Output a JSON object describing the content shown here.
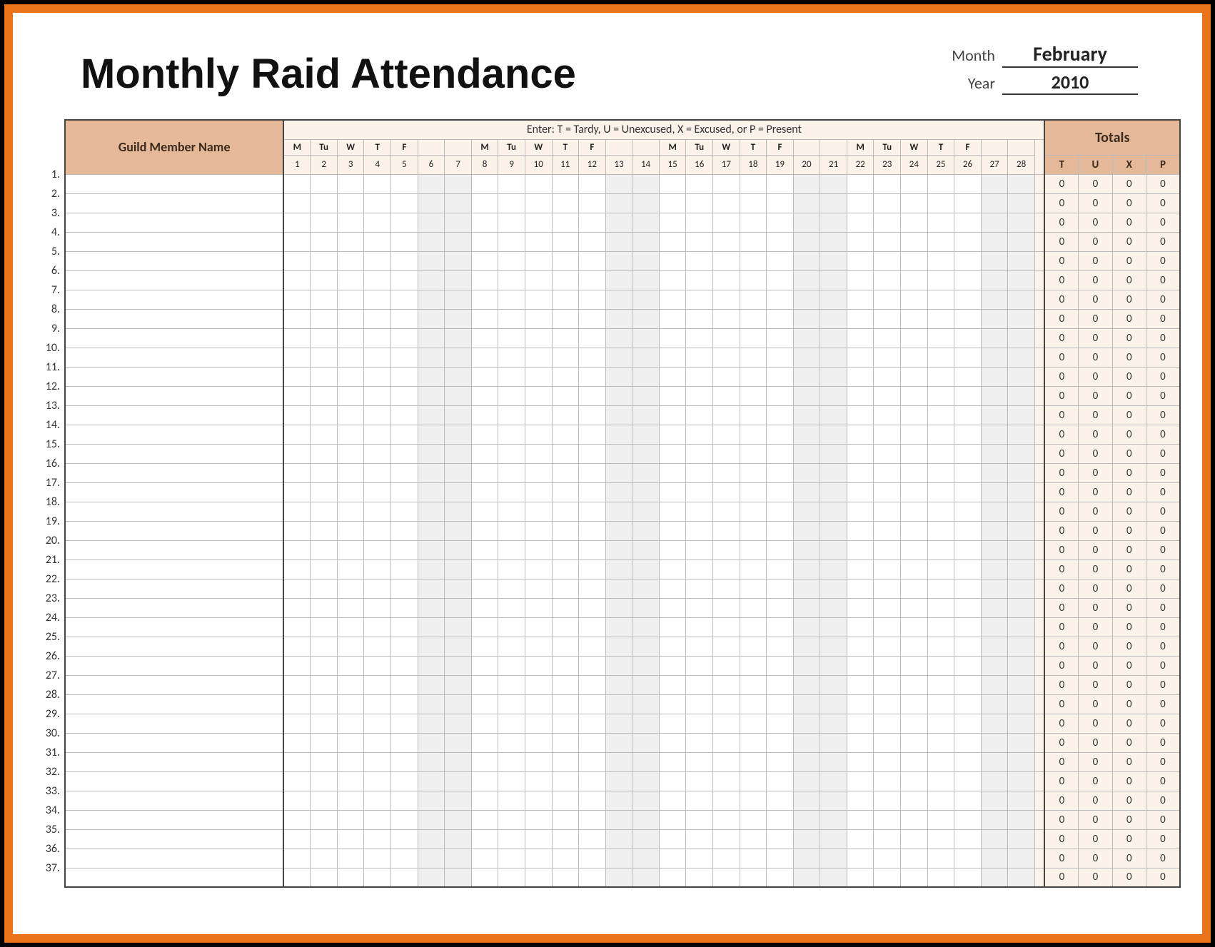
{
  "title": "Monthly Raid Attendance",
  "meta": {
    "month_label": "Month",
    "month_value": "February",
    "year_label": "Year",
    "year_value": "2010"
  },
  "legend": "Enter: T = Tardy,  U = Unexcused,  X = Excused,  or P = Present",
  "name_header": "Guild Member Name",
  "totals_header": "Totals",
  "total_codes": [
    "T",
    "U",
    "X",
    "P"
  ],
  "dow_pattern": [
    "M",
    "Tu",
    "W",
    "T",
    "F",
    "",
    "",
    "M",
    "Tu",
    "W",
    "T",
    "F",
    "",
    "",
    "M",
    "Tu",
    "W",
    "T",
    "F",
    "",
    "",
    "M",
    "Tu",
    "W",
    "T",
    "F",
    "",
    ""
  ],
  "day_numbers": [
    "1",
    "2",
    "3",
    "4",
    "5",
    "6",
    "7",
    "8",
    "9",
    "10",
    "11",
    "12",
    "13",
    "14",
    "15",
    "16",
    "17",
    "18",
    "19",
    "20",
    "21",
    "22",
    "23",
    "24",
    "25",
    "26",
    "27",
    "28"
  ],
  "weekend_days": [
    6,
    7,
    13,
    14,
    20,
    21,
    27,
    28
  ],
  "row_count": 37,
  "default_totals": [
    0,
    0,
    0,
    0
  ]
}
